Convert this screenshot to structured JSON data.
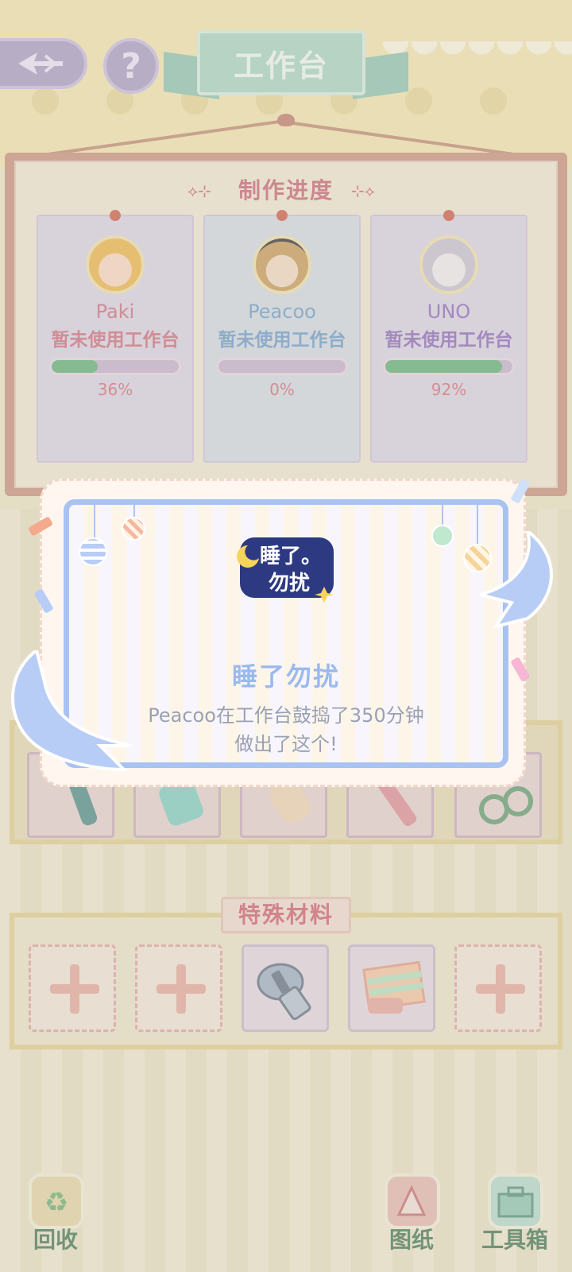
{
  "header": {
    "title": "工作台",
    "help_label": "?"
  },
  "progress_board": {
    "title": "制作进度",
    "workers": [
      {
        "name": "Paki",
        "status": "暂未使用工作台",
        "progress": 0.36,
        "progress_text": "36%",
        "name_color": "#d06a80",
        "card_color": "#dcd4ea"
      },
      {
        "name": "Peacoo",
        "status": "暂未使用工作台",
        "progress": 0.0,
        "progress_text": "0%",
        "name_color": "#6a9ad0",
        "card_color": "#d4dcea"
      },
      {
        "name": "UNO",
        "status": "暂未使用工作台",
        "progress": 0.92,
        "progress_text": "92%",
        "name_color": "#8a64c0",
        "card_color": "#dcd4ea"
      }
    ]
  },
  "special_materials": {
    "title": "特殊材料"
  },
  "popup": {
    "title": "睡了勿扰",
    "message_line1": "Peacoo在工作台鼓捣了350分钟",
    "message_line2": "做出了这个!",
    "logo_text_top": "睡了。",
    "logo_text_bottom": "勿扰"
  },
  "bottom_nav": {
    "recycle_label": "回收",
    "blueprint_label": "图纸",
    "toolbox_label": "工具箱"
  }
}
